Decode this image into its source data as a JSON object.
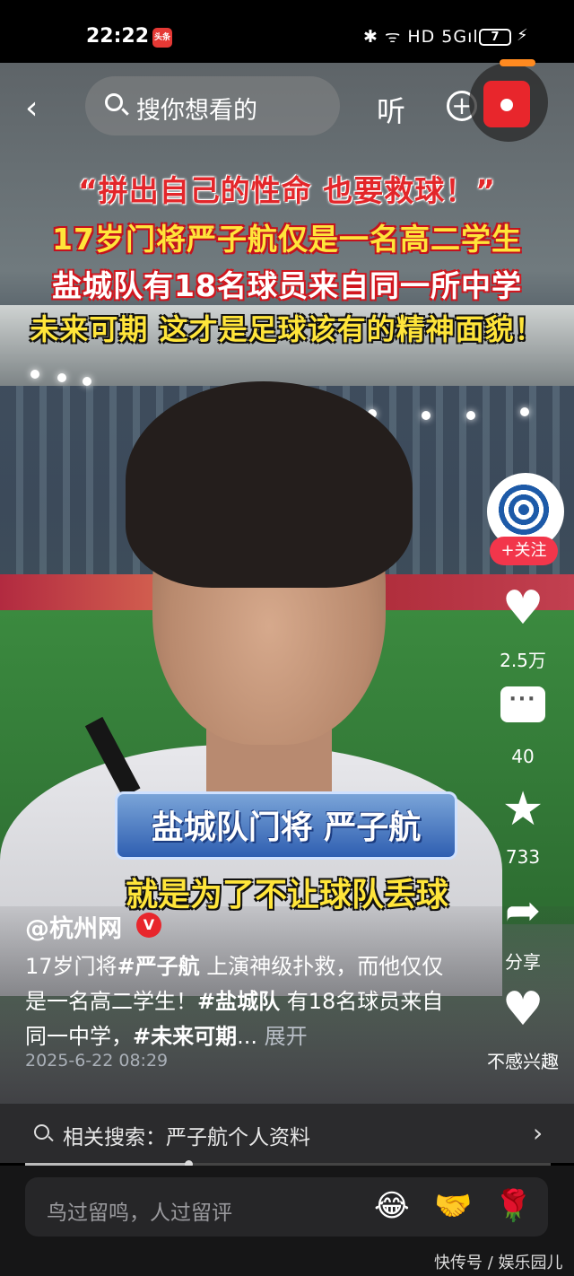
{
  "status_bar": {
    "time": "22:22",
    "app_badge": "头条",
    "network": "5G",
    "icons": "✱ ᯤ HD 5Gıl",
    "battery": "7"
  },
  "nav": {
    "search_placeholder": "搜你想看的",
    "listen_label": "听"
  },
  "video": {
    "headline_1": "“拼出自己的性命 也要救球！”",
    "headline_2": "17岁门将严子航仅是一名高二学生",
    "headline_3": "盐城队有18名球员来自同一所中学",
    "headline_4": "未来可期 这才是足球该有的精神面貌！",
    "caption_name": "盐城队门将 严子航",
    "caption_subtitle": "就是为了不让球队丢球"
  },
  "rail": {
    "follow_label": "+关注",
    "likes": "2.5万",
    "comments": "40",
    "favorites": "733",
    "share_label": "分享",
    "dislike_label": "不感兴趣"
  },
  "post": {
    "author": "@杭州网",
    "verified_badge": "V",
    "desc_part1": "17岁门将",
    "tag1": "#严子航",
    "desc_part2": " 上演神级扑救，而他仅仅是一名高二学生！",
    "tag2": "#盐城队",
    "desc_part3": " 有18名球员来自同一中学，",
    "tag3": "#未来可期",
    "ellipsis": "...",
    "expand_label": "展开",
    "date": "2025-6-22 08:29"
  },
  "related": {
    "label": "相关搜索：严子航个人资料"
  },
  "playback": {
    "progress_fraction": 0.31
  },
  "comment": {
    "placeholder": "鸟过留鸣，人过留评",
    "emojis": [
      "😂",
      "🤝",
      "🌹"
    ]
  },
  "watermark": "快传号 / 娱乐园儿",
  "colors": {
    "accent_red": "#e8262c",
    "follow_red": "#f2364b",
    "headline_yellow": "#ffe53a"
  }
}
